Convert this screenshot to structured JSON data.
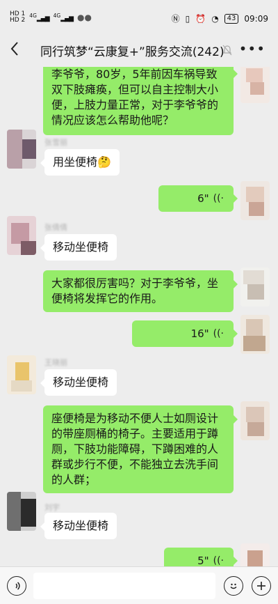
{
  "status_bar": {
    "sim1": "HD 1",
    "sim2": "HD 2",
    "net1": "4G",
    "net2": "4G",
    "battery": "43",
    "time": "09:09"
  },
  "nav": {
    "title": "同行筑梦“云康复+”服务交流(242)",
    "back_icon": "chevron-left-icon",
    "mute_icon": "mute-bell-icon",
    "more_icon": "more-dots-icon"
  },
  "messages": [
    {
      "side": "out",
      "type": "text",
      "text": "李爷爷，80岁，5年前因车祸导致双下肢瘫痪，但可以自主控制大小便，上肢力量正常，对于李爷爷的情况应该怎么帮助他呢？"
    },
    {
      "side": "in",
      "type": "text",
      "sender": "张雪丽",
      "text": "用坐便椅🤔"
    },
    {
      "side": "out",
      "type": "voice",
      "duration": "6\""
    },
    {
      "side": "in",
      "type": "text",
      "sender": "张倩倩",
      "text": "移动坐便椅"
    },
    {
      "side": "out",
      "type": "text",
      "text": "大家都很厉害吗？对于李爷爷，坐便椅将发挥它的作用。"
    },
    {
      "side": "out",
      "type": "voice",
      "duration": "16\""
    },
    {
      "side": "in",
      "type": "text",
      "sender": "王晓丽",
      "text": "移动坐便椅"
    },
    {
      "side": "out",
      "type": "text",
      "text": "座便椅是为移动不便人士如厕设计的带座厕桶的椅子。主要适用于蹲厕，下肢功能障碍，下蹲困难的人群或步行不便，不能独立去洗手间的人群；"
    },
    {
      "side": "in",
      "type": "text",
      "sender": "刘宇",
      "text": "移动坐便椅"
    },
    {
      "side": "out",
      "type": "voice",
      "duration": "5\""
    }
  ],
  "input_bar": {
    "voice_icon": "voice-mode-icon",
    "emoji_icon": "emoji-icon",
    "plus_icon": "plus-icon",
    "placeholder": ""
  }
}
